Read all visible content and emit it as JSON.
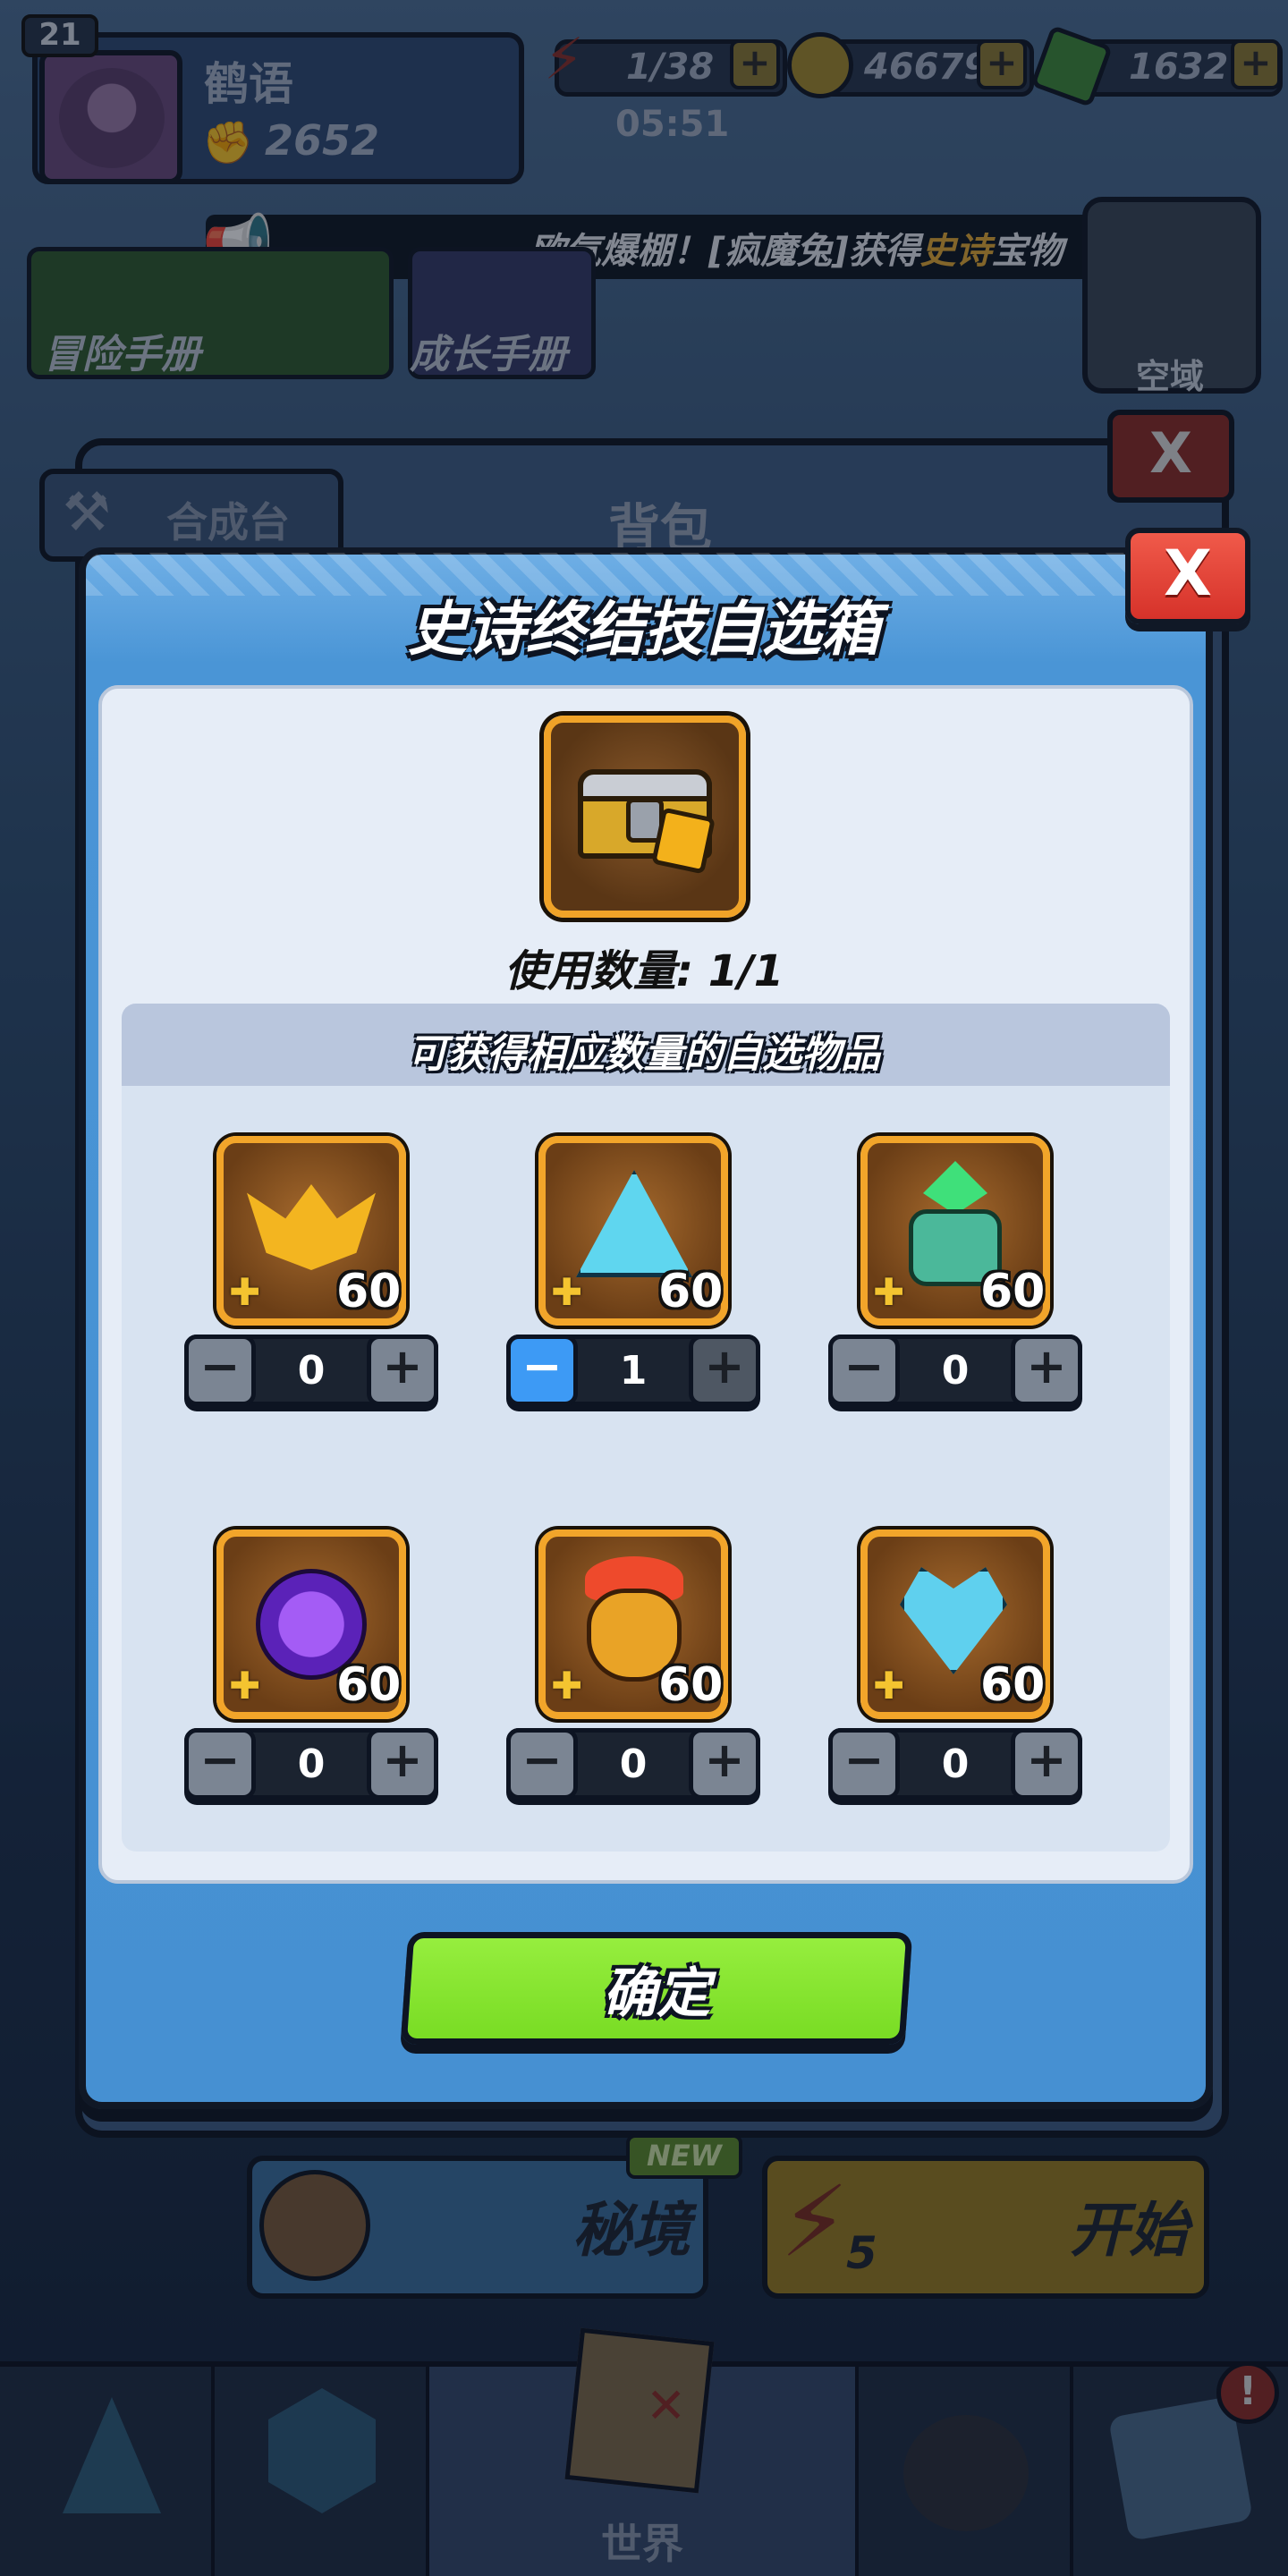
{
  "hud": {
    "level": "21",
    "player_name": "鹤语",
    "power": "2652",
    "stamina": "1/38",
    "stamina_timer": "05:51",
    "gold": "46679",
    "gems": "1632",
    "plus": "+"
  },
  "announcement": {
    "prefix": "欧气爆棚！[疯魔兔]获得",
    "highlight": "史诗",
    "suffix": "宝物"
  },
  "menu": {
    "adventure_manual": "冒险手册",
    "growth_manual": "成长手册",
    "skyfield": "空域"
  },
  "bag": {
    "tab_label": "合成台",
    "title": "背包",
    "close": "X"
  },
  "bottom": {
    "secret_realm": "秘境",
    "new_badge": "NEW",
    "start": "开始",
    "start_cost": "5"
  },
  "nav": {
    "world": "世界",
    "alert": "!"
  },
  "modal": {
    "title": "史诗终结技自选箱",
    "close": "X",
    "usage_label": "使用数量: 1/1",
    "items_header": "可获得相应数量的自选物品",
    "confirm": "确定",
    "items": [
      {
        "name": "golden-bat-wing",
        "level": "60",
        "count": "0",
        "minus": "−",
        "plus": "+"
      },
      {
        "name": "ice-triangle-pendant",
        "level": "60",
        "count": "1",
        "minus": "−",
        "plus": "+"
      },
      {
        "name": "green-crystal-lantern",
        "level": "60",
        "count": "0",
        "minus": "−",
        "plus": "+"
      },
      {
        "name": "purple-rune-orb",
        "level": "60",
        "count": "0",
        "minus": "−",
        "plus": "+"
      },
      {
        "name": "fire-owl-urn",
        "level": "60",
        "count": "0",
        "minus": "−",
        "plus": "+"
      },
      {
        "name": "ice-heart-amulet",
        "level": "60",
        "count": "0",
        "minus": "−",
        "plus": "+"
      }
    ]
  },
  "colors": {
    "modal_blue": "#4690d2",
    "confirm_green": "#79dc24",
    "frame_gold": "#f2a52a",
    "minus_active": "#3d9af5",
    "close_red": "#d6322a",
    "highlight_gold": "#e3a933"
  }
}
